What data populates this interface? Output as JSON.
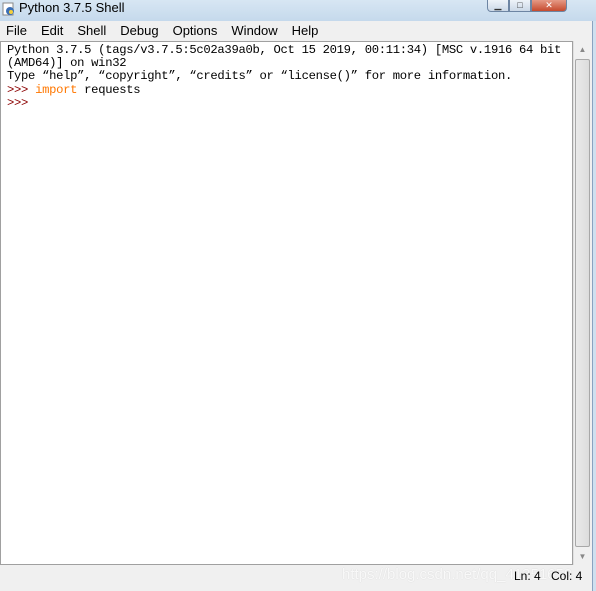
{
  "window": {
    "title": "Python 3.7.5 Shell",
    "icon": "python-idle-icon",
    "controls": [
      "minimize",
      "maximize",
      "close"
    ]
  },
  "menu": [
    "File",
    "Edit",
    "Shell",
    "Debug",
    "Options",
    "Window",
    "Help"
  ],
  "shell": {
    "banner_line1": "Python 3.7.5 (tags/v3.7.5:5c02a39a0b, Oct 15 2019, 00:11:34) [MSC v.1916 64 bit",
    "banner_line2": "(AMD64)] on win32",
    "banner_line3": "Type “help”, “copyright”, “credits” or “license()” for more information.",
    "prompt": ">>> ",
    "line4_keyword": "import",
    "line4_rest": " requests",
    "colors": {
      "prompt": "#8b0000",
      "keyword": "#ff7700"
    }
  },
  "status": {
    "ln": "Ln: 4",
    "col": "Col: 4"
  },
  "watermark": "https://blog.csdn.net/qq_41351659"
}
